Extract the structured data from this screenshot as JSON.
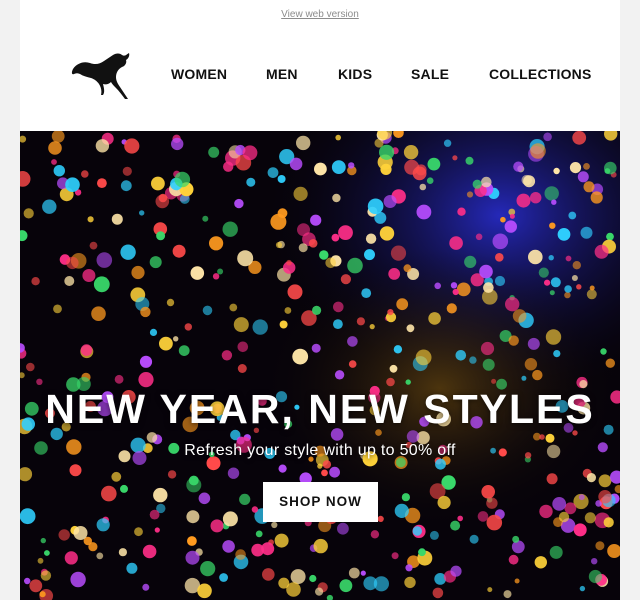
{
  "header": {
    "view_web_version": "View web version",
    "logo_icon": "puma-cat-icon",
    "nav": [
      "WOMEN",
      "MEN",
      "KIDS",
      "SALE",
      "COLLECTIONS"
    ]
  },
  "hero": {
    "title": "NEW YEAR, NEW STYLES",
    "subtitle": "Refresh your style with up to 50% off",
    "cta_label": "SHOP NOW",
    "background": "bokeh-lights-image"
  },
  "colors": {
    "page_bg": "#f2f2f2",
    "nav_text": "#111111",
    "hero_text": "#ffffff",
    "button_bg": "#ffffff",
    "bokeh": [
      "#ff2e88",
      "#ff9a1f",
      "#ffd23a",
      "#2fd0ff",
      "#39d86a",
      "#b94dff",
      "#ff4a4a",
      "#ffe6a8"
    ]
  }
}
